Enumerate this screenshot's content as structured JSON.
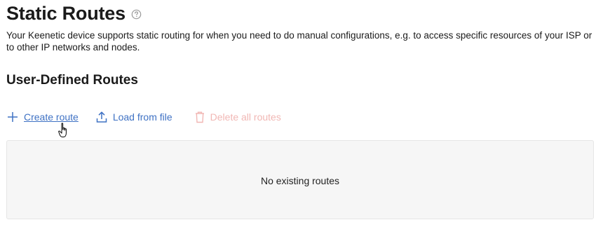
{
  "page": {
    "title": "Static Routes",
    "description": "Your Keenetic device supports static routing for when you need to do manual configurations, e.g. to access specific resources of your ISP or to other IP networks and nodes."
  },
  "section": {
    "title": "User-Defined Routes"
  },
  "toolbar": {
    "create_label": "Create route",
    "load_label": "Load from file",
    "delete_label": "Delete all routes"
  },
  "routes": {
    "empty_message": "No existing routes"
  },
  "colors": {
    "link": "#3f72c4",
    "disabled_danger": "#f1b7b4",
    "panel_bg": "#f6f6f6"
  },
  "icons": {
    "help": "help-icon",
    "create": "plus-icon",
    "load": "upload-icon",
    "delete": "trash-icon",
    "cursor": "hand-pointer-cursor"
  }
}
